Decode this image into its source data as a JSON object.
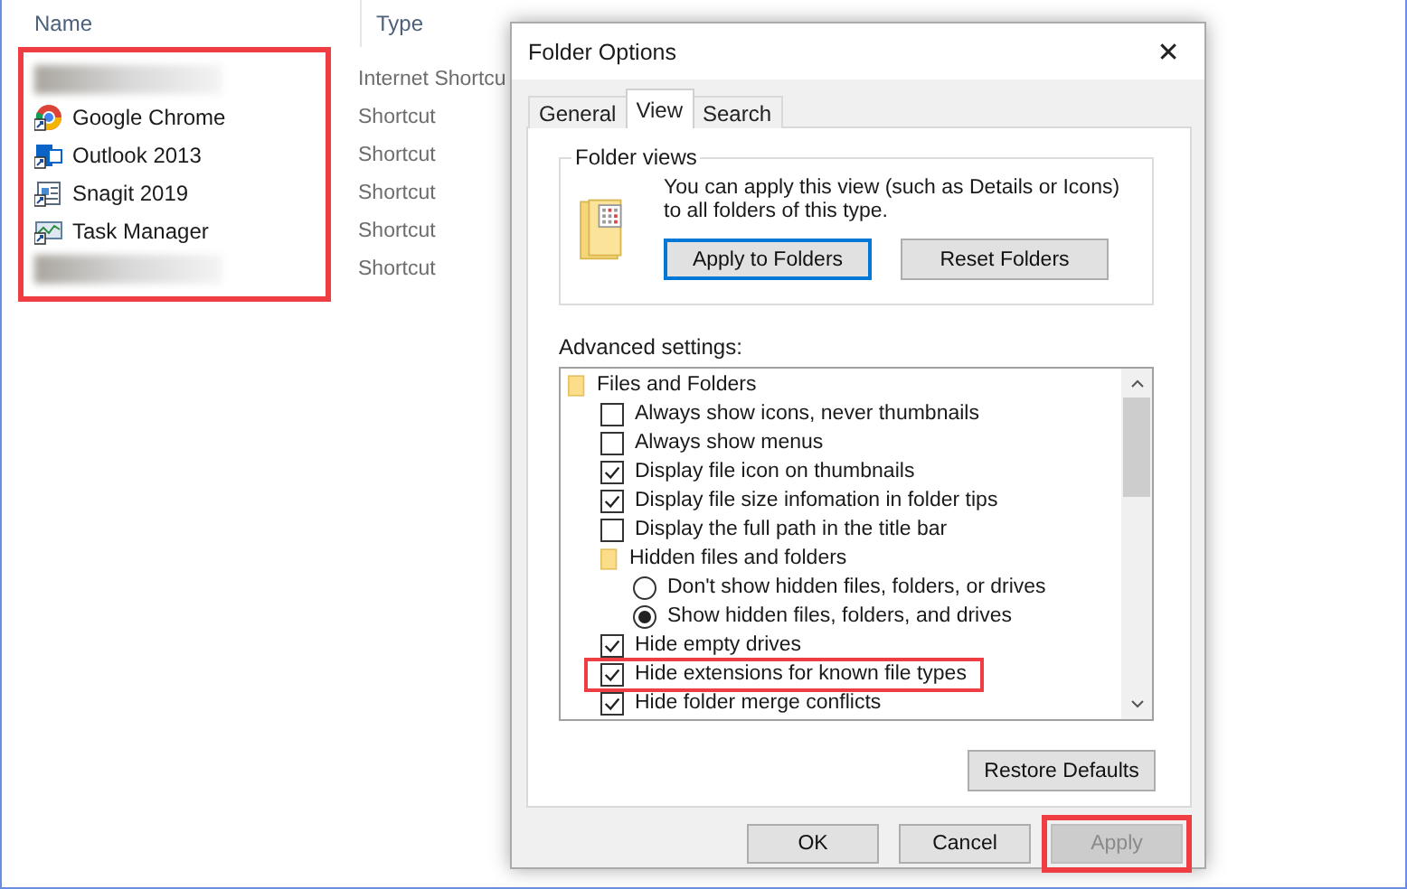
{
  "explorer": {
    "columns": [
      "Name",
      "Type"
    ],
    "highlighted": true,
    "rows": [
      {
        "kind": "blurred",
        "type": "Internet Shortcu"
      },
      {
        "kind": "item",
        "name": "Google Chrome",
        "type": "Shortcut"
      },
      {
        "kind": "item",
        "name": "Outlook 2013",
        "type": "Shortcut"
      },
      {
        "kind": "item",
        "name": "Snagit 2019",
        "type": "Shortcut"
      },
      {
        "kind": "item",
        "name": "Task Manager",
        "type": "Shortcut"
      },
      {
        "kind": "blurred",
        "type": "Shortcut"
      }
    ]
  },
  "dialog": {
    "title": "Folder Options",
    "close": "✕",
    "tabs": [
      {
        "label": "General",
        "selected": false
      },
      {
        "label": "View",
        "selected": true
      },
      {
        "label": "Search",
        "selected": false
      }
    ],
    "folder_views": {
      "title": "Folder views",
      "text": "You can apply this view (such as Details or Icons) to all folders of this type.",
      "buttons": [
        {
          "label": "Apply to Folders",
          "focused": true
        },
        {
          "label": "Reset Folders",
          "focused": false
        }
      ]
    },
    "advanced_label": "Advanced settings:",
    "settings": [
      {
        "kind": "folder",
        "label": "Files and Folders",
        "children": [
          {
            "kind": "checkbox",
            "label": "Always show icons, never thumbnails",
            "checked": false,
            "highlighted": false
          },
          {
            "kind": "checkbox",
            "label": "Always show menus",
            "checked": false,
            "highlighted": false
          },
          {
            "kind": "checkbox",
            "label": "Display file icon on thumbnails",
            "checked": true,
            "highlighted": false
          },
          {
            "kind": "checkbox",
            "label": "Display file size infomation in folder tips",
            "checked": true,
            "highlighted": false
          },
          {
            "kind": "checkbox",
            "label": "Display the full path in the title bar",
            "checked": false,
            "highlighted": false
          },
          {
            "kind": "folder",
            "label": "Hidden files and folders",
            "children": [
              {
                "kind": "radio",
                "label": "Don't show hidden files, folders, or drives",
                "selected": false
              },
              {
                "kind": "radio",
                "label": "Show hidden files, folders, and drives",
                "selected": true
              }
            ]
          },
          {
            "kind": "checkbox",
            "label": "Hide empty drives",
            "checked": true,
            "highlighted": false
          },
          {
            "kind": "checkbox",
            "label": "Hide extensions for known file types",
            "checked": true,
            "highlighted": true
          },
          {
            "kind": "checkbox",
            "label": "Hide folder merge conflicts",
            "checked": true,
            "highlighted": false
          }
        ]
      }
    ],
    "restore": "Restore Defaults",
    "buttons": [
      {
        "label": "OK",
        "disabled": false,
        "highlighted": false
      },
      {
        "label": "Cancel",
        "disabled": false,
        "highlighted": false
      },
      {
        "label": "Apply",
        "disabled": true,
        "highlighted": true
      }
    ]
  }
}
